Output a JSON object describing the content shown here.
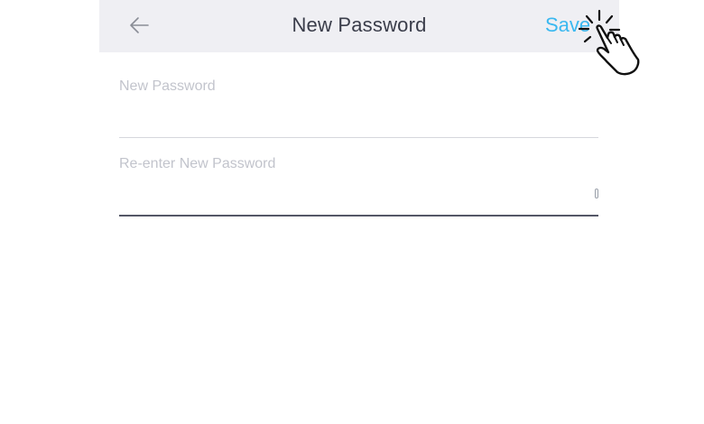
{
  "header": {
    "back_icon": "arrow-left-icon",
    "title": "New Password",
    "save_label": "Save"
  },
  "form": {
    "new_password": {
      "label": "New Password",
      "value": ""
    },
    "reenter_password": {
      "label": "Re-enter New Password",
      "value": ""
    }
  },
  "overlay": {
    "icon": "tap-hand-icon"
  },
  "colors": {
    "header_bg": "#efeff3",
    "accent": "#3ab8f0",
    "title_text": "#3a3d4a",
    "label_text": "#c2c4cc"
  }
}
